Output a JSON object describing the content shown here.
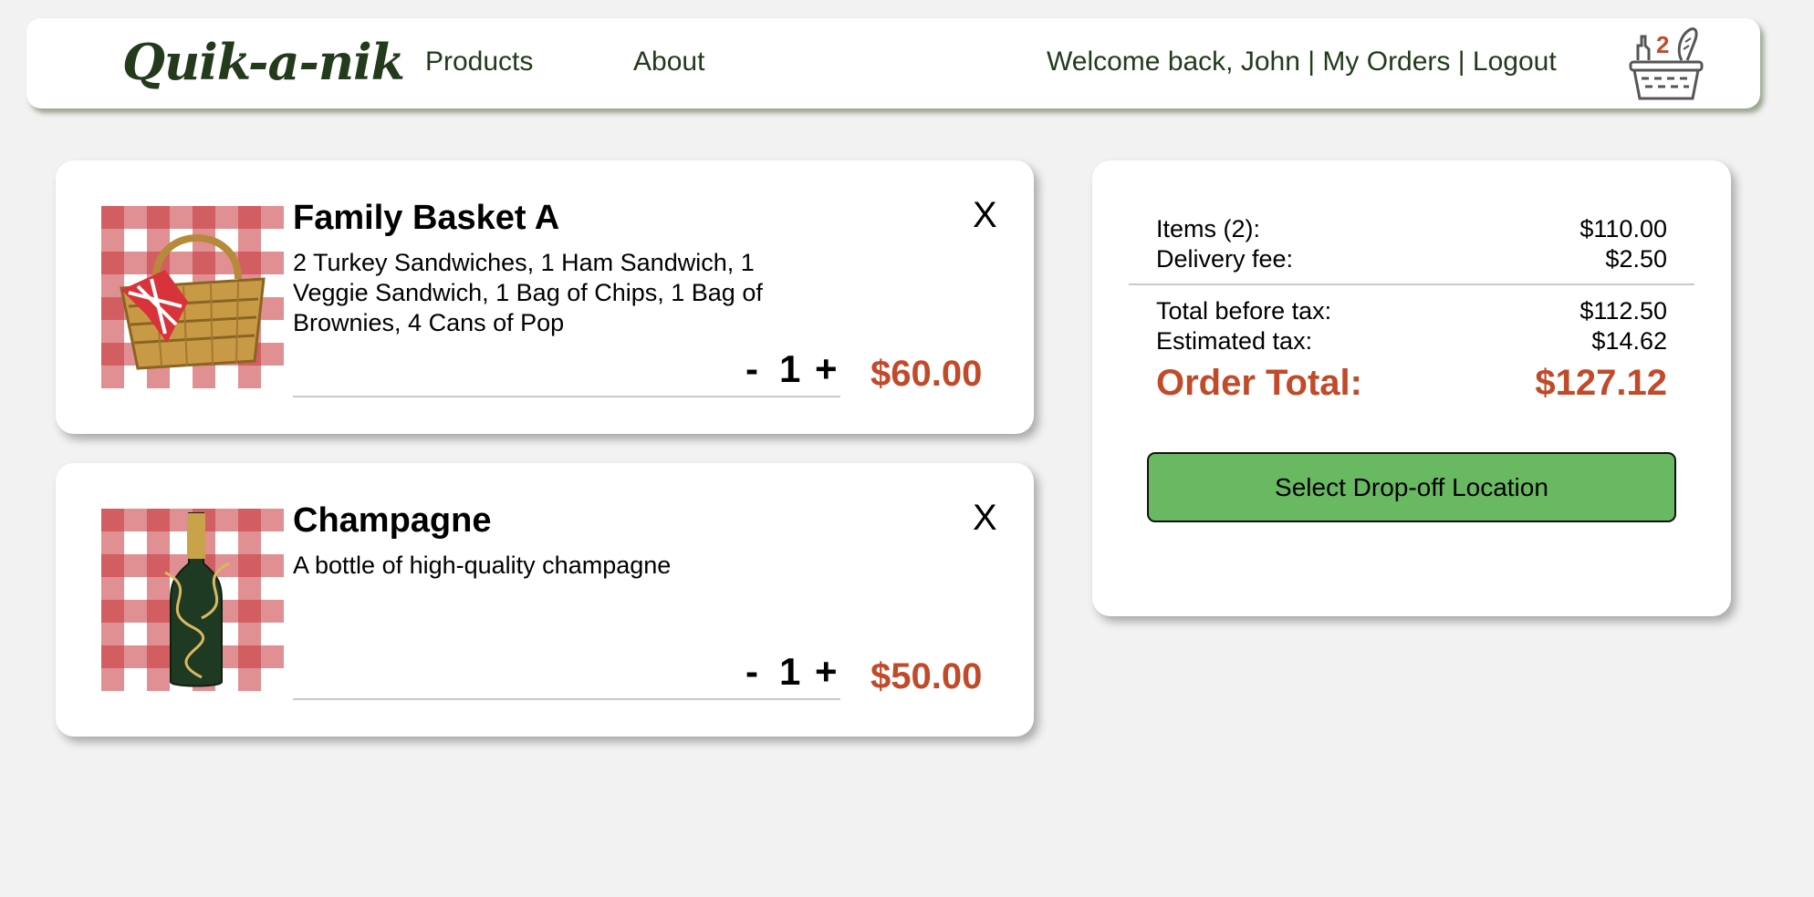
{
  "nav": {
    "logo": "Quik-a-nik",
    "products": "Products",
    "about": "About",
    "welcome": "Welcome back, John",
    "separator": "|",
    "my_orders": "My Orders",
    "logout": "Logout",
    "cart_count": "2",
    "cart_icon": "picnic-basket-icon"
  },
  "cart": {
    "items": [
      {
        "title": "Family Basket A",
        "description": "2 Turkey Sandwiches, 1 Ham Sandwich, 1 Veggie Sandwich, 1 Bag of Chips, 1 Bag of Brownies, 4 Cans of Pop",
        "remove": "X",
        "minus": "-",
        "quantity": "1",
        "plus": "+",
        "price": "$60.00"
      },
      {
        "title": "Champagne",
        "description": "A bottle of high-quality champagne",
        "remove": "X",
        "minus": "-",
        "quantity": "1",
        "plus": "+",
        "price": "$50.00"
      }
    ]
  },
  "summary": {
    "items_label": "Items (2):",
    "items_value": "$110.00",
    "delivery_label": "Delivery fee:",
    "delivery_value": "$2.50",
    "before_tax_label": "Total before tax:",
    "before_tax_value": "$112.50",
    "tax_label": "Estimated tax:",
    "tax_value": "$14.62",
    "total_label": "Order Total:",
    "total_value": "$127.12",
    "cta": "Select Drop-off Location"
  },
  "colors": {
    "accent": "#c14a2a",
    "brand_green": "#233a1c",
    "button_green": "#69b862",
    "gingham_red": "#c7353a"
  }
}
